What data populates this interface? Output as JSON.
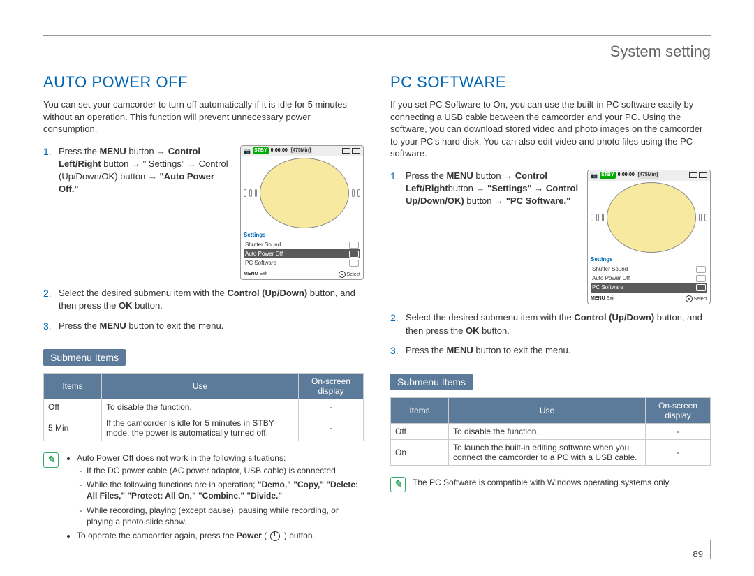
{
  "header": {
    "section": "System setting"
  },
  "page_number": "89",
  "left": {
    "title": "AUTO POWER OFF",
    "intro": "You can set your camcorder to turn off automatically if it is idle for 5 minutes without an operation. This function will prevent unnecessary power consumption.",
    "steps": {
      "s1a": "Press the ",
      "s1b": "MENU",
      "s1c": " button → ",
      "s1d": "Control Left/Right",
      "s1e": " button → \" Settings\" → Control (Up/Down/OK)",
      "s1f": " button → ",
      "s1g": "\"Auto Power Off.\"",
      "s2a": "Select the desired submenu item with the ",
      "s2b": "Control (Up/Down)",
      "s2c": " button, and then press the ",
      "s2d": "OK",
      "s2e": " button.",
      "s3a": "Press the ",
      "s3b": "MENU",
      "s3c": " button to exit the menu."
    },
    "screen": {
      "stby": "STBY",
      "time": "0:00:00",
      "dur": "[475Min]",
      "settings": "Settings",
      "items": [
        "Shutter Sound",
        "Auto Power Off",
        "PC Software"
      ],
      "selected": "Auto Power Off",
      "exit_a": "MENU",
      "exit_b": "Exit",
      "sel": "Select"
    },
    "sub_tag": "Submenu Items",
    "table": {
      "h1": "Items",
      "h2": "Use",
      "h3": "On-screen display",
      "r1c1": "Off",
      "r1c2": "To disable the function.",
      "r1c3": "-",
      "r2c1": "5 Min",
      "r2c2": "If the camcorder is idle for 5 minutes in STBY mode, the power is automatically turned off.",
      "r2c3": "-"
    },
    "note": {
      "b1": "Auto Power Off does not work in the following situations:",
      "s1": "If the DC power cable (AC power adaptor, USB cable) is connected",
      "s2a": "While the following functions are in operation; ",
      "s2b": "\"Demo,\" \"Copy,\" \"Delete: All Files,\" \"Protect: All On,\" \"Combine,\" \"Divide.\"",
      "s3": "While recording, playing (except pause), pausing while recording, or playing a photo slide show.",
      "b2a": "To operate the camcorder again, press the ",
      "b2b": "Power",
      "b2c": " button."
    }
  },
  "right": {
    "title": "PC SOFTWARE",
    "intro": "If you set PC Software to On, you can use the built-in PC software easily by connecting a USB cable between the camcorder and your PC. Using the software, you can download stored video and photo images on the camcorder to your PC's hard disk. You can also edit video and photo files using the PC software.",
    "steps": {
      "s1a": "Press the ",
      "s1b": "MENU",
      "s1c": " button → ",
      "s1d": "Control Left/Right",
      "s1e": "button → ",
      "s1f": "\"Settings\"",
      "s1g": " → ",
      "s1h": "Control Up/Down/OK)",
      "s1i": " button → ",
      "s1j": "\"PC Software.\"",
      "s2a": "Select the desired submenu item with the ",
      "s2b": "Control (Up/Down)",
      "s2c": " button, and then press the ",
      "s2d": "OK",
      "s2e": " button.",
      "s3a": "Press the ",
      "s3b": "MENU",
      "s3c": " button to exit the menu."
    },
    "screen": {
      "stby": "STBY",
      "time": "0:00:00",
      "dur": "[475Min]",
      "settings": "Settings",
      "items": [
        "Shutter Sound",
        "Auto Power Off",
        "PC Software"
      ],
      "selected": "PC Software",
      "exit_a": "MENU",
      "exit_b": "Exit",
      "sel": "Select"
    },
    "sub_tag": "Submenu Items",
    "table": {
      "h1": "Items",
      "h2": "Use",
      "h3": "On-screen display",
      "r1c1": "Off",
      "r1c2": "To disable the function.",
      "r1c3": "-",
      "r2c1": "On",
      "r2c2": "To launch the built-in editing software when you connect the camcorder to a PC with a USB cable.",
      "r2c3": "-"
    },
    "note": "The PC Software is compatible with Windows operating systems only."
  }
}
